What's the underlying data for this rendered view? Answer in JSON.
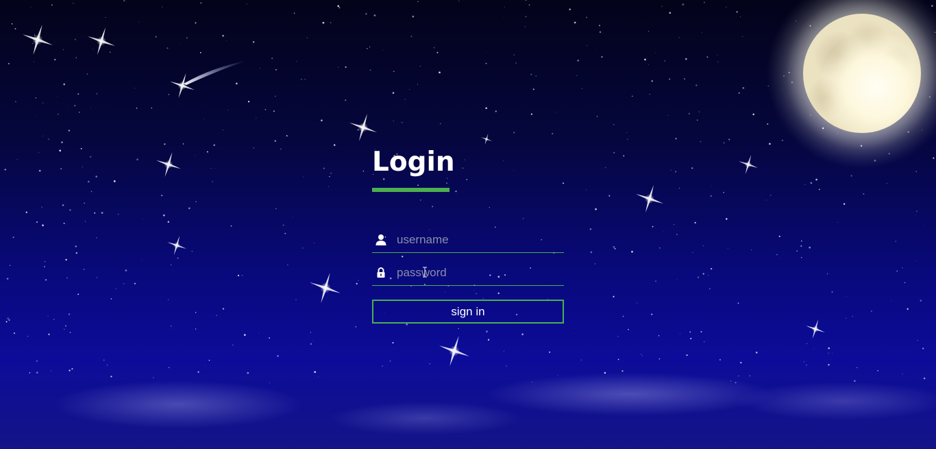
{
  "login": {
    "title": "Login",
    "username": {
      "placeholder": "username",
      "value": "",
      "icon": "user-icon"
    },
    "password": {
      "placeholder": "password",
      "value": "",
      "icon": "lock-icon"
    },
    "submit_label": "sign in"
  },
  "colors": {
    "accent": "#4caf50",
    "text": "#ffffff",
    "placeholder": "#8b8da8",
    "sky_top": "#03031a",
    "sky_bottom": "#0c0c9a",
    "moon": "#f4edd0"
  }
}
